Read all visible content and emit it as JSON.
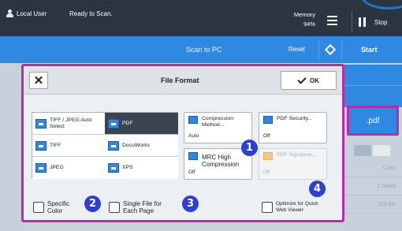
{
  "statusbar": {
    "user_label": "Local User",
    "status_text": "Ready to Scan.",
    "memory_label": "Memory",
    "memory_value": "94%",
    "stop_label": "Stop"
  },
  "scanbar": {
    "title": "Scan to PC",
    "reset_label": "Reset",
    "start_label": "Start"
  },
  "background": {
    "format_value": ".pdf",
    "list_values": [
      "Color",
      "1 Sided",
      "200 dpi"
    ]
  },
  "dialog": {
    "title": "File Format",
    "ok_label": "OK",
    "file_types": [
      {
        "label": "TIFF / JPEG Auto Select",
        "selected": false
      },
      {
        "label": "PDF",
        "selected": true
      },
      {
        "label": "TIFF",
        "selected": false
      },
      {
        "label": "DocuWorks",
        "selected": false
      },
      {
        "label": "JPEG",
        "selected": false
      },
      {
        "label": "XPS",
        "selected": false
      }
    ],
    "options": {
      "compression": {
        "label": "Compression Method...",
        "value": "Auto"
      },
      "pdf_security": {
        "label": "PDF Security...",
        "value": "Off"
      },
      "mrc": {
        "label": "MRC High Compression",
        "value": "Off"
      },
      "pdf_signature": {
        "label": "PDF Signature...",
        "value": "Off"
      }
    },
    "checkboxes": {
      "specific_color": "Specific Color",
      "single_file": "Single File for Each Page",
      "optimize": "Optimize for Quick Web Viewer"
    },
    "badges": [
      "1",
      "2",
      "3",
      "4"
    ]
  },
  "colors": {
    "accent_blue": "#2f89e0",
    "highlight_magenta": "#b52ea6",
    "badge_blue": "#2f3fd0",
    "statusbar_dark": "#2b3440"
  }
}
